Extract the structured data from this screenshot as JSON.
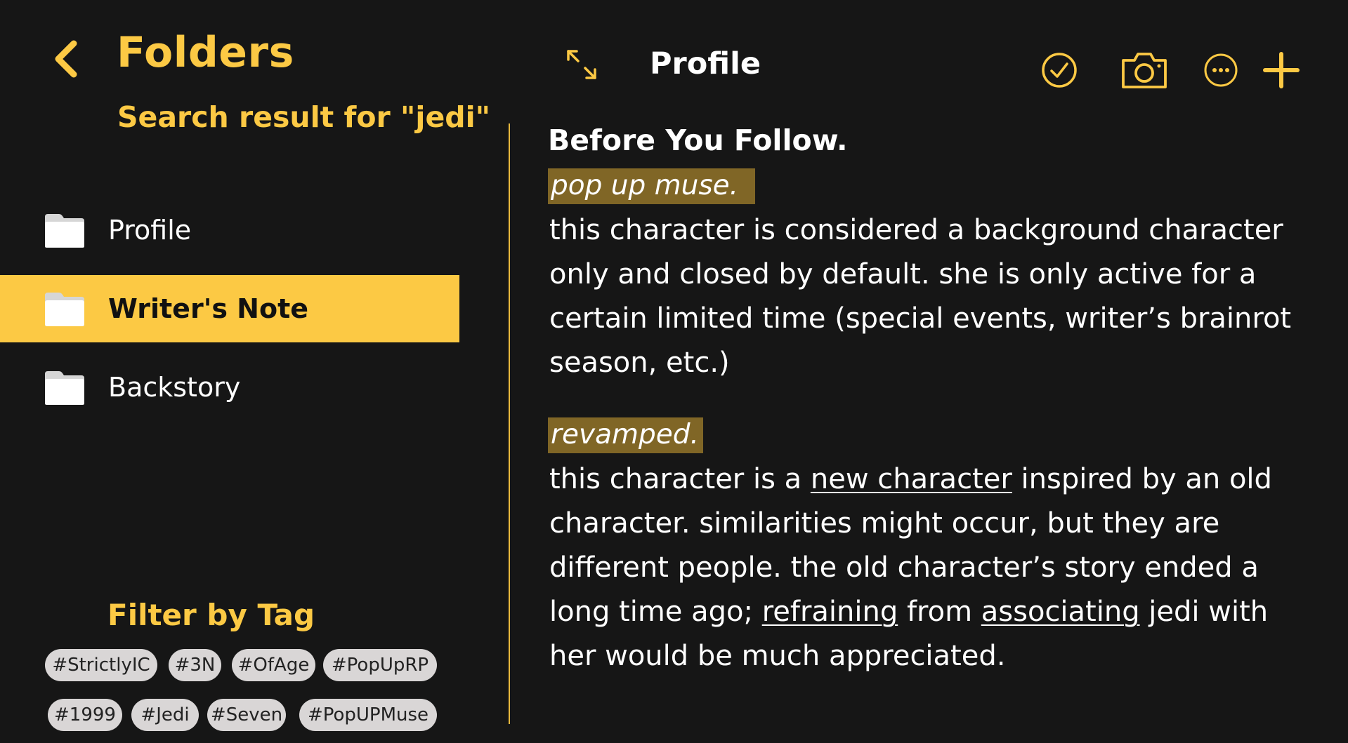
{
  "sidebar": {
    "title": "Folders",
    "search_result": "Search result for \"jedi\"",
    "folders": [
      {
        "label": "Profile",
        "selected": false
      },
      {
        "label": "Writer's Note",
        "selected": true
      },
      {
        "label": "Backstory",
        "selected": false
      }
    ],
    "filter_title": "Filter by Tag",
    "tags": [
      "#StrictlyIC",
      "#3N",
      "#OfAge",
      "#PopUpRP",
      "#1999",
      "#Jedi",
      "#Seven",
      "#PopUPMuse"
    ]
  },
  "header": {
    "title": "Profile",
    "icons": [
      "expand-icon",
      "check-circle-icon",
      "camera-icon",
      "more-icon",
      "plus-icon"
    ]
  },
  "note": {
    "heading": "Before You Follow.",
    "section1": {
      "highlight": "pop up muse.",
      "text": "this character is considered a background character only and closed by default. she is only active for a certain limited time (special events, writer’s brainrot season, etc.)"
    },
    "section2": {
      "highlight": "revamped.",
      "t1": "this character is a ",
      "link1": "new character",
      "t2": " inspired by an old character. similarities might occur, but they are different people. the old character’s story ended a long time ago; ",
      "link2": "refraining",
      "t3": " from ",
      "link3": "associating",
      "t4": " jedi with her would be much appreciated."
    }
  },
  "colors": {
    "background": "#161616",
    "accent": "#fcc944",
    "highlight": "#806626",
    "tag_bg": "#d9d6d6"
  }
}
